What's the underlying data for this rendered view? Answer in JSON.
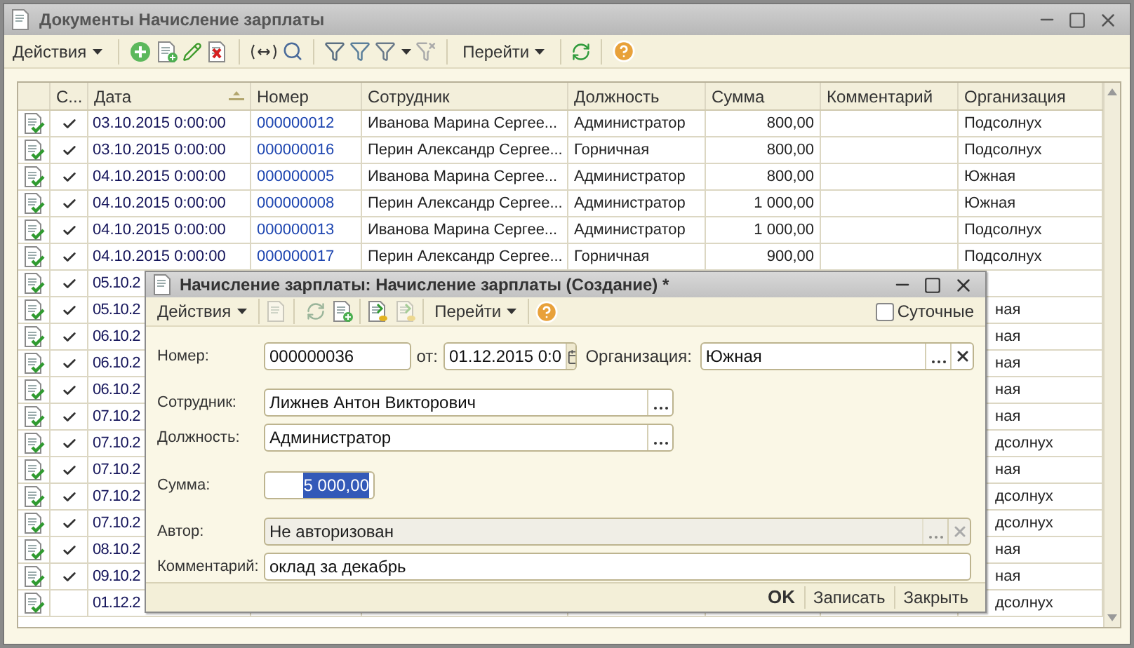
{
  "window": {
    "title": "Документы Начисление зарплаты"
  },
  "toolbar": {
    "actions_menu": "Действия",
    "goto_menu": "Перейти"
  },
  "table": {
    "columns": [
      {
        "label": "С...",
        "sorted": false
      },
      {
        "label": "Дата",
        "sorted": true
      },
      {
        "label": "Номер",
        "sorted": false
      },
      {
        "label": "Сотрудник",
        "sorted": false
      },
      {
        "label": "Должность",
        "sorted": false
      },
      {
        "label": "Сумма",
        "sorted": false
      },
      {
        "label": "Комментарий",
        "sorted": false
      },
      {
        "label": "Организация",
        "sorted": false
      }
    ],
    "rows": [
      {
        "kind": "full",
        "posted": true,
        "date": "03.10.2015 0:00:00",
        "number": "000000012",
        "employee": "Иванова Марина Сергее...",
        "position": "Администратор",
        "amount": "800,00",
        "organization": "Подсолнух"
      },
      {
        "kind": "full",
        "posted": true,
        "date": "03.10.2015 0:00:00",
        "number": "000000016",
        "employee": "Перин Александр Сергее...",
        "position": "Горничная",
        "amount": "800,00",
        "organization": "Подсолнух"
      },
      {
        "kind": "full",
        "posted": true,
        "date": "04.10.2015 0:00:00",
        "number": "000000005",
        "employee": "Иванова Марина Сергее...",
        "position": "Администратор",
        "amount": "800,00",
        "organization": "Южная"
      },
      {
        "kind": "full",
        "posted": true,
        "date": "04.10.2015 0:00:00",
        "number": "000000008",
        "employee": "Перин Александр Сергее...",
        "position": "Администратор",
        "amount": "1 000,00",
        "organization": "Южная"
      },
      {
        "kind": "full",
        "posted": true,
        "date": "04.10.2015 0:00:00",
        "number": "000000013",
        "employee": "Иванова Марина Сергее...",
        "position": "Администратор",
        "amount": "1 000,00",
        "organization": "Подсолнух"
      },
      {
        "kind": "full",
        "posted": true,
        "date": "04.10.2015 0:00:00",
        "number": "000000017",
        "employee": "Перин Александр Сергее...",
        "position": "Горничная",
        "amount": "900,00",
        "organization": "Подсолнух"
      },
      {
        "kind": "covered",
        "posted": true,
        "date": "05.10.2"
      },
      {
        "kind": "covered",
        "posted": true,
        "date": "05.10.2",
        "organization": "ная"
      },
      {
        "kind": "covered",
        "posted": true,
        "date": "06.10.2",
        "organization": "ная"
      },
      {
        "kind": "covered",
        "posted": true,
        "date": "06.10.2",
        "organization": "ная"
      },
      {
        "kind": "covered",
        "posted": true,
        "date": "06.10.2",
        "organization": "ная"
      },
      {
        "kind": "covered",
        "posted": true,
        "date": "07.10.2",
        "organization": "ная"
      },
      {
        "kind": "covered",
        "posted": true,
        "date": "07.10.2",
        "organization": "дсолнух"
      },
      {
        "kind": "covered",
        "posted": true,
        "date": "07.10.2",
        "organization": "ная"
      },
      {
        "kind": "covered",
        "posted": true,
        "date": "07.10.2",
        "organization": "дсолнух"
      },
      {
        "kind": "covered",
        "posted": true,
        "date": "07.10.2",
        "organization": "дсолнух"
      },
      {
        "kind": "covered",
        "posted": true,
        "date": "08.10.2",
        "organization": "ная"
      },
      {
        "kind": "covered",
        "posted": true,
        "date": "09.10.2",
        "organization": "ная"
      },
      {
        "kind": "covered",
        "posted": false,
        "date": "01.12.2",
        "organization": "дсолнух"
      }
    ]
  },
  "dialog": {
    "title": "Начисление зарплаты: Начисление зарплаты (Создание) *",
    "toolbar": {
      "actions_menu": "Действия",
      "goto_menu": "Перейти"
    },
    "daily": {
      "label": "Суточные",
      "checked": false
    },
    "number": {
      "label": "Номер:",
      "value": "000000036"
    },
    "date": {
      "label": "от:",
      "value": "01.12.2015  0:0"
    },
    "organization": {
      "label": "Организация:",
      "value": "Южная"
    },
    "employee": {
      "label": "Сотрудник:",
      "value": "Лижнев Антон Викторович"
    },
    "position": {
      "label": "Должность:",
      "value": "Администратор"
    },
    "amount": {
      "label": "Сумма:",
      "value": "5 000,00",
      "selected": true
    },
    "author": {
      "label": "Автор:",
      "value": "Не авторизован",
      "disabled": true
    },
    "comment": {
      "label": "Комментарий:",
      "value": "оклад за декабрь"
    },
    "buttons": [
      {
        "label": "OK",
        "default": true
      },
      {
        "label": "Записать",
        "default": false
      },
      {
        "label": "Закрыть",
        "default": false
      }
    ]
  }
}
